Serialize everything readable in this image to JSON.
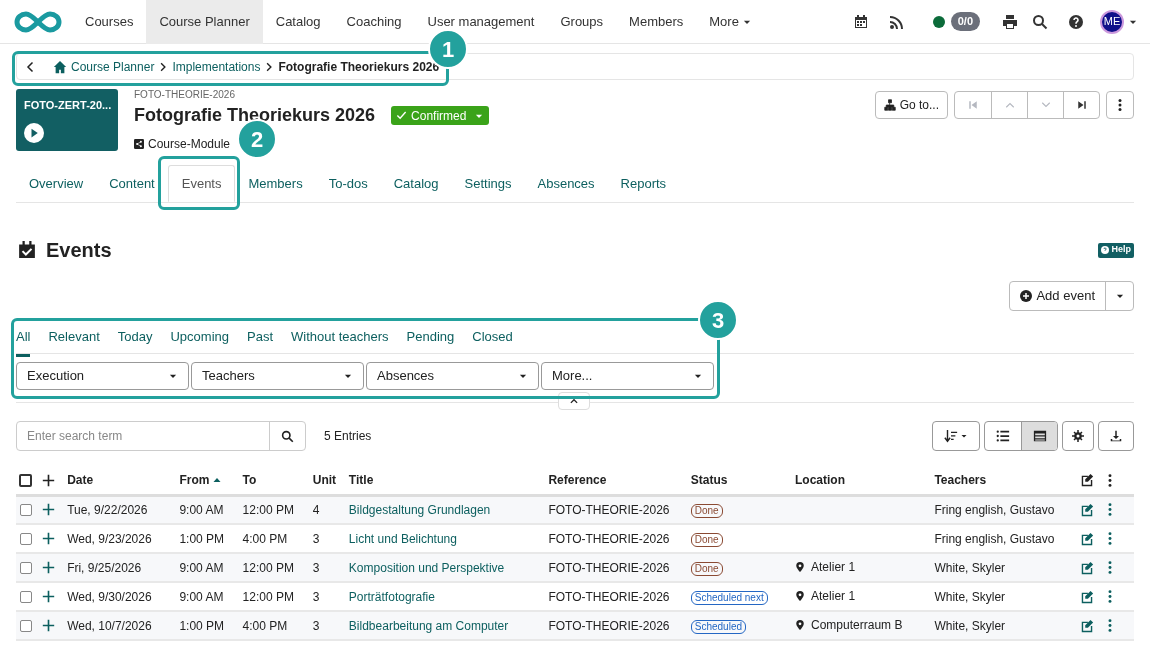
{
  "nav": {
    "items": [
      {
        "label": "Courses",
        "selected": false
      },
      {
        "label": "Course Planner",
        "selected": true
      },
      {
        "label": "Catalog",
        "selected": false
      },
      {
        "label": "Coaching",
        "selected": false
      },
      {
        "label": "User management",
        "selected": false
      },
      {
        "label": "Groups",
        "selected": false
      },
      {
        "label": "Members",
        "selected": false
      },
      {
        "label": "More",
        "selected": false
      }
    ],
    "counter": "0/0",
    "avatar": "ME"
  },
  "breadcrumb": [
    "Course Planner",
    "Implementations",
    "Fotografie Theoriekurs 2026"
  ],
  "course": {
    "thumbnail_label": "FOTO-ZERT-20...",
    "reference": "FOTO-THEORIE-2026",
    "title": "Fotografie Theoriekurs 2026",
    "status": "Confirmed",
    "type": "Course-Module",
    "goto": "Go to..."
  },
  "pager": [
    {
      "kind": "first",
      "disabled": true
    },
    {
      "kind": "up",
      "disabled": true
    },
    {
      "kind": "down",
      "disabled": true
    },
    {
      "kind": "last",
      "disabled": false
    }
  ],
  "tabs": [
    {
      "label": "Overview",
      "selected": false
    },
    {
      "label": "Content",
      "selected": false
    },
    {
      "label": "Events",
      "selected": true
    },
    {
      "label": "Members",
      "selected": false
    },
    {
      "label": "To-dos",
      "selected": false
    },
    {
      "label": "Catalog",
      "selected": false
    },
    {
      "label": "Settings",
      "selected": false
    },
    {
      "label": "Absences",
      "selected": false
    },
    {
      "label": "Reports",
      "selected": false
    }
  ],
  "section": {
    "title": "Events",
    "help": "Help",
    "add_button": "Add event"
  },
  "filter_tabs": [
    {
      "label": "All",
      "selected": true
    },
    {
      "label": "Relevant",
      "selected": false
    },
    {
      "label": "Today",
      "selected": false
    },
    {
      "label": "Upcoming",
      "selected": false
    },
    {
      "label": "Past",
      "selected": false
    },
    {
      "label": "Without teachers",
      "selected": false
    },
    {
      "label": "Pending",
      "selected": false
    },
    {
      "label": "Closed",
      "selected": false
    }
  ],
  "filters": [
    "Execution",
    "Teachers",
    "Absences",
    "More..."
  ],
  "search": {
    "placeholder": "Enter search term"
  },
  "entries": "5 Entries",
  "table": {
    "all_selected": false,
    "columns": [
      "Date",
      "From",
      "To",
      "Unit",
      "Title",
      "Reference",
      "Status",
      "Location",
      "Teachers"
    ],
    "rows": [
      {
        "selected": false,
        "date": "Tue, 9/22/2026",
        "from": "9:00 AM",
        "to": "12:00 PM",
        "unit": "4",
        "title": "Bildgestaltung Grundlagen",
        "reference": "FOTO-THEORIE-2026",
        "status": {
          "label": "Done",
          "kind": "done"
        },
        "location": "",
        "teachers": "Fring english, Gustavo"
      },
      {
        "selected": false,
        "date": "Wed, 9/23/2026",
        "from": "1:00 PM",
        "to": "4:00 PM",
        "unit": "3",
        "title": "Licht und Belichtung",
        "reference": "FOTO-THEORIE-2026",
        "status": {
          "label": "Done",
          "kind": "done"
        },
        "location": "",
        "teachers": "Fring english, Gustavo"
      },
      {
        "selected": false,
        "date": "Fri, 9/25/2026",
        "from": "9:00 AM",
        "to": "12:00 PM",
        "unit": "3",
        "title": "Komposition und Perspektive",
        "reference": "FOTO-THEORIE-2026",
        "status": {
          "label": "Done",
          "kind": "done"
        },
        "location": "Atelier 1",
        "teachers": "White, Skyler"
      },
      {
        "selected": false,
        "date": "Wed, 9/30/2026",
        "from": "9:00 AM",
        "to": "12:00 PM",
        "unit": "3",
        "title": "Porträtfotografie",
        "reference": "FOTO-THEORIE-2026",
        "status": {
          "label": "Scheduled next",
          "kind": "scheduled"
        },
        "location": "Atelier 1",
        "teachers": "White, Skyler"
      },
      {
        "selected": false,
        "date": "Wed, 10/7/2026",
        "from": "1:00 PM",
        "to": "4:00 PM",
        "unit": "3",
        "title": "Bildbearbeitung am Computer",
        "reference": "FOTO-THEORIE-2026",
        "status": {
          "label": "Scheduled",
          "kind": "scheduled"
        },
        "location": "Computerraum B",
        "teachers": "White, Skyler"
      }
    ]
  },
  "callouts": [
    "1",
    "2",
    "3"
  ]
}
